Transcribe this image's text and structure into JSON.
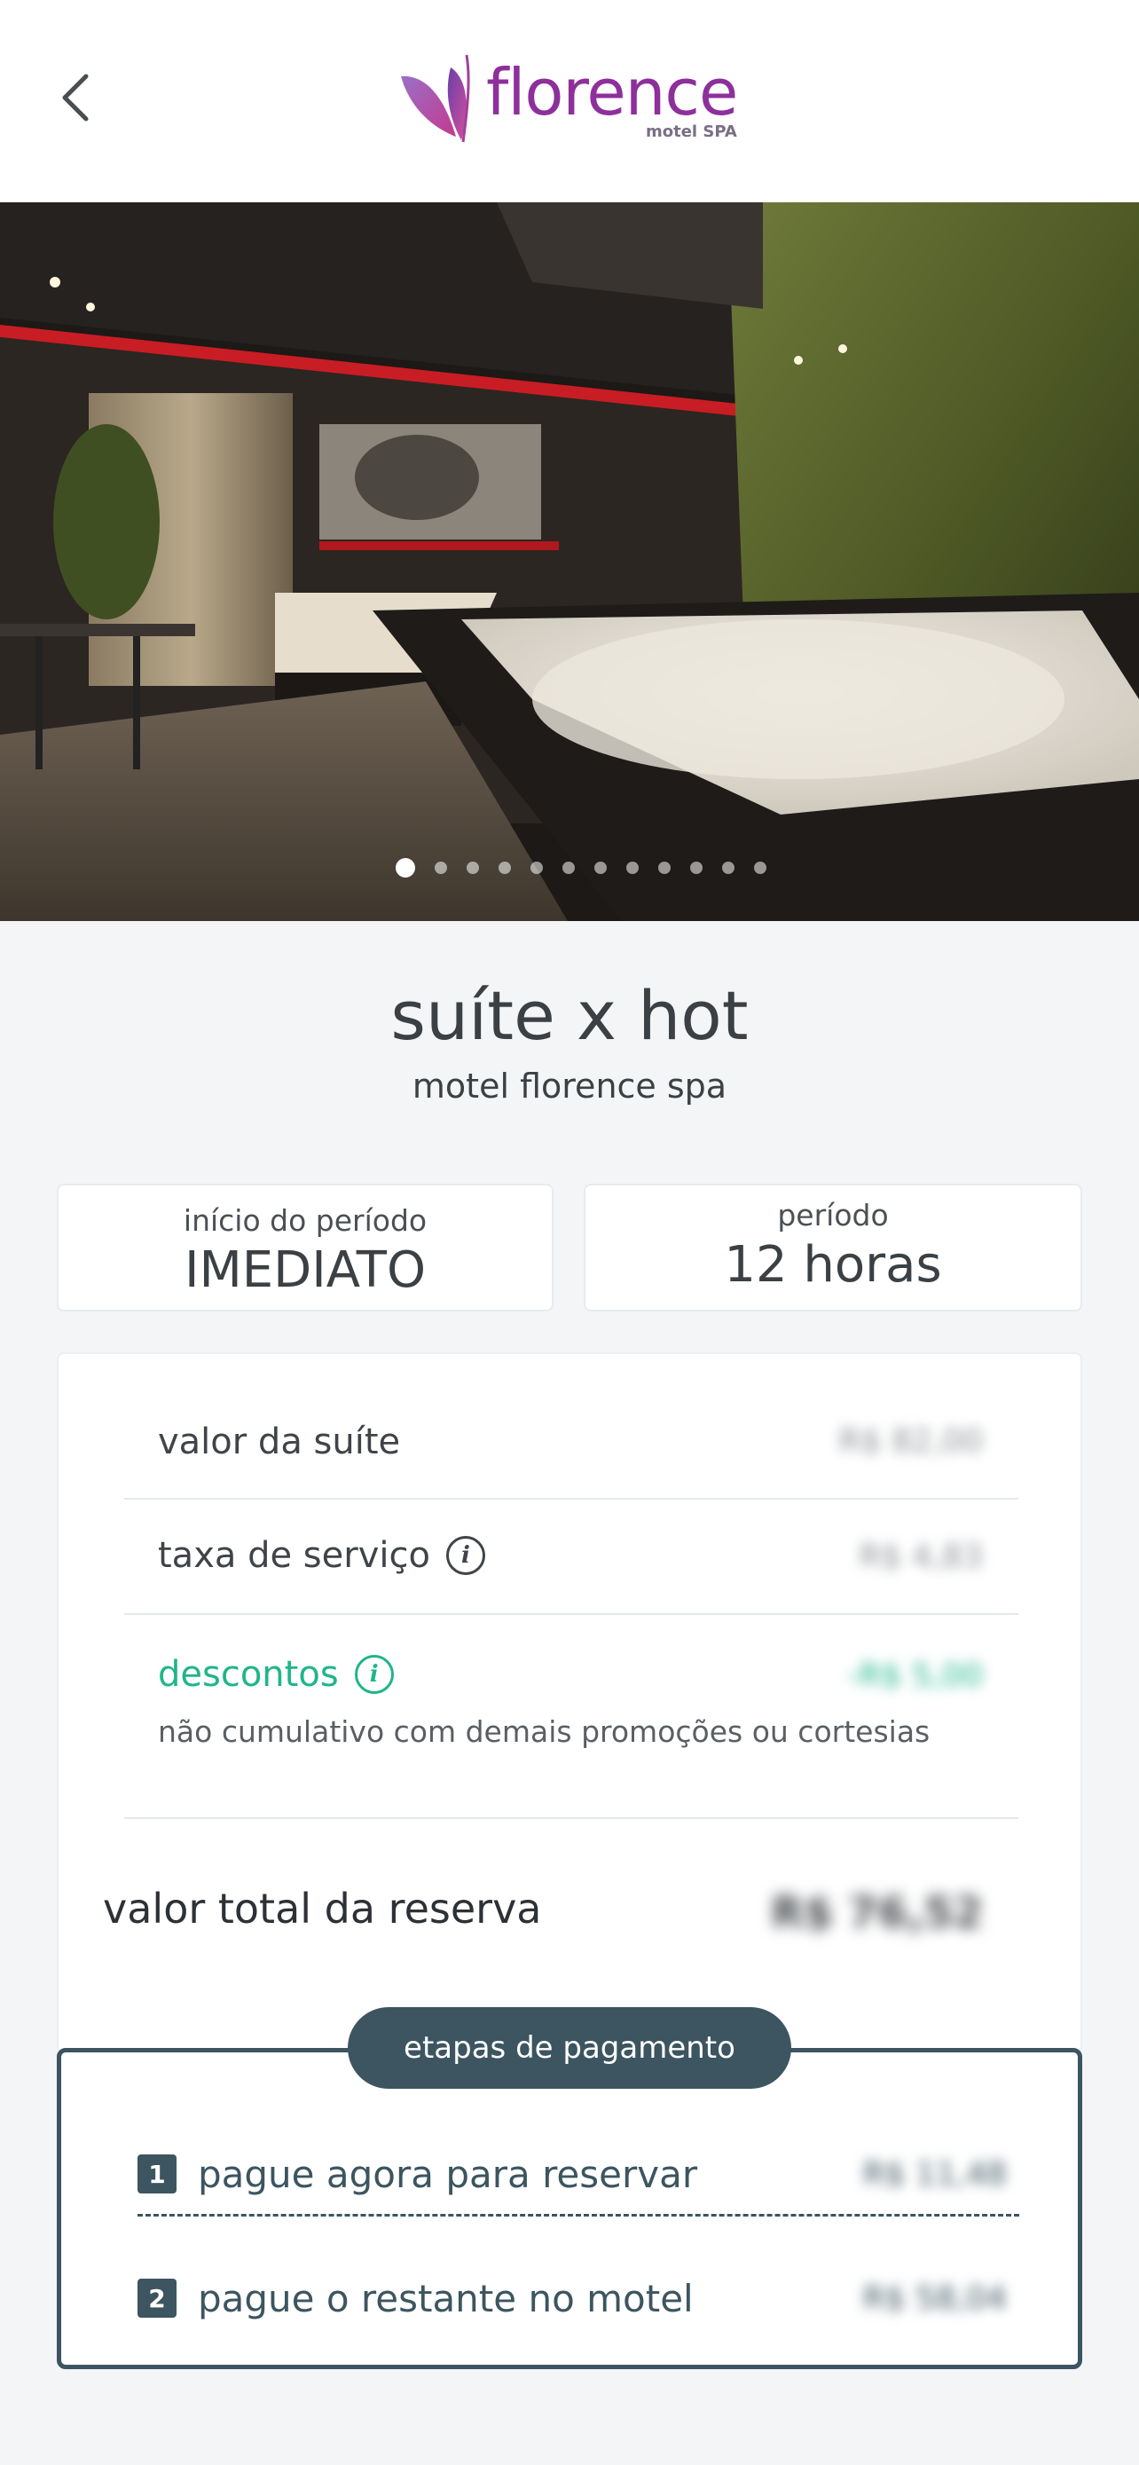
{
  "header": {
    "back_icon": "chevron-left-icon",
    "logo_text": "florence",
    "logo_sub": "motel SPA"
  },
  "carousel": {
    "total_images": 12,
    "active_index": 0
  },
  "suite": {
    "title": "suíte x hot",
    "motel": "motel florence spa"
  },
  "period": {
    "start_label": "início do período",
    "start_value": "IMEDIATO",
    "duration_label": "período",
    "duration_value": "12 horas"
  },
  "pricing": {
    "suite_label": "valor da suíte",
    "suite_value": "R$ 82,00",
    "fee_label": "taxa de serviço",
    "fee_value": "R$ 4,83",
    "discount_label": "descontos",
    "discount_value": "-R$ 5,00",
    "discount_note": "não cumulativo com demais promoções ou cortesias",
    "total_label": "valor total da reserva",
    "total_value": "R$ 76,52"
  },
  "payment": {
    "title": "etapas de pagamento",
    "step1_num": "1",
    "step1_label": "pague agora para reservar",
    "step1_value": "R$ 11,48",
    "step2_num": "2",
    "step2_label": "pague o restante no motel",
    "step2_value": "R$ 58,04"
  },
  "colors": {
    "brand_purple": "#8e2f9c",
    "accent_green": "#1fb58a",
    "steps_dark": "#3c5560"
  }
}
